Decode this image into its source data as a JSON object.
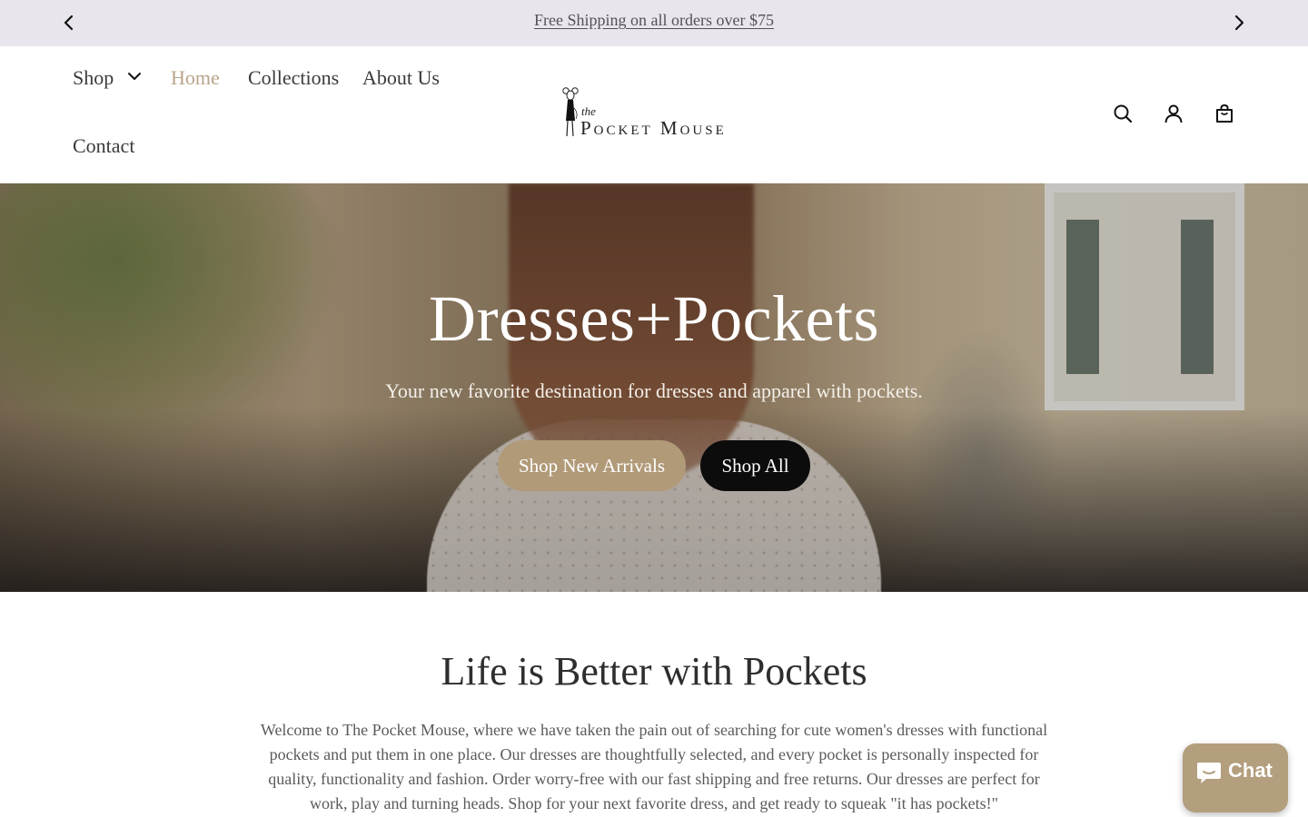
{
  "announcement": {
    "message": "Free Shipping on all orders over $75",
    "prev_icon": "chevron-left-icon",
    "next_icon": "chevron-right-icon"
  },
  "header": {
    "nav": [
      {
        "label": "Shop",
        "active": false,
        "has_dropdown": true
      },
      {
        "label": "Home",
        "active": true
      },
      {
        "label": "Collections",
        "active": false
      },
      {
        "label": "About Us",
        "active": false
      },
      {
        "label": "Contact",
        "active": false
      }
    ],
    "logo": {
      "small": "the",
      "name": "Pocket Mouse"
    },
    "icons": [
      "search-icon",
      "account-icon",
      "cart-icon"
    ]
  },
  "hero": {
    "title": "Dresses+Pockets",
    "subtitle": "Your new favorite destination for dresses and apparel with pockets.",
    "primary_button": "Shop New Arrivals",
    "secondary_button": "Shop All"
  },
  "intro": {
    "title": "Life is Better with Pockets",
    "body": "Welcome to The Pocket Mouse, where we have taken the pain out of searching for cute women's dresses with functional pockets and put them in one place. Our dresses are thoughtfully selected, and every pocket is personally inspected for quality, functionality and fashion. Order worry-free with our fast shipping and free returns. Our dresses are perfect for work, play and turning heads. Shop for your next favorite dress, and get ready to squeak \"it has pockets!\""
  },
  "chat": {
    "label": "Chat"
  },
  "colors": {
    "announcement_bg": "#e8e6ec",
    "accent_tan": "#b19a78",
    "active_nav": "#b9a48a",
    "button_dark": "#0c0c0c"
  }
}
